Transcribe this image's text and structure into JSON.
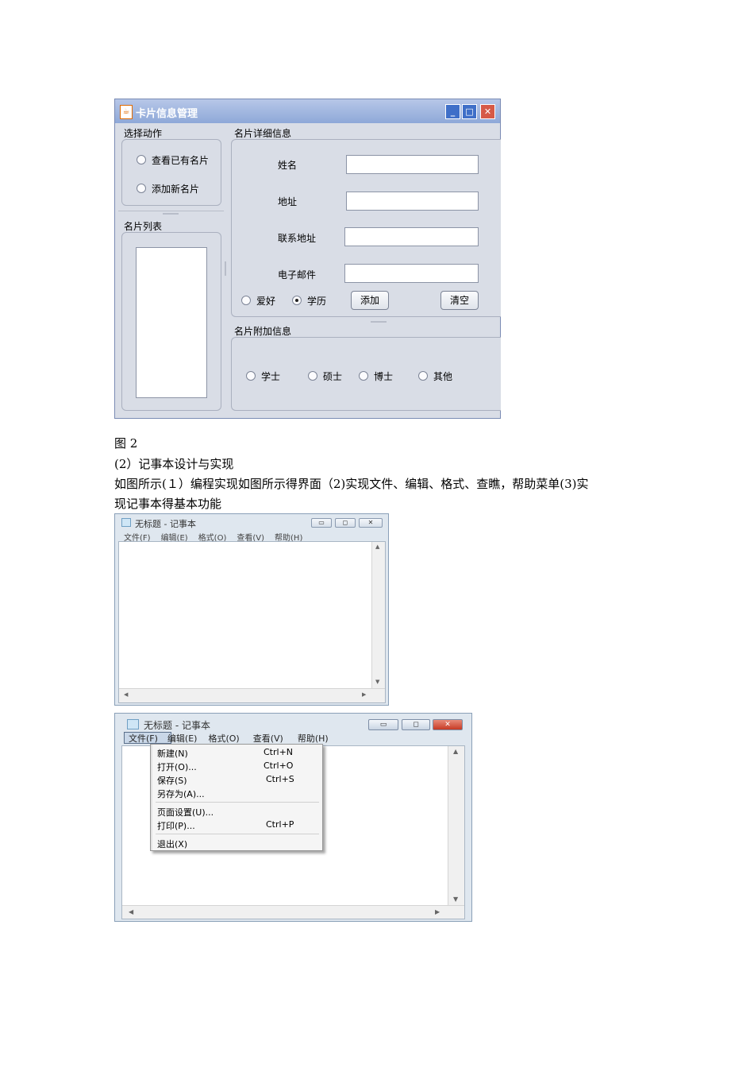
{
  "card_window": {
    "title": "卡片信息管理",
    "choose_action": {
      "label": "选择动作",
      "options": [
        "查看已有名片",
        "添加新名片"
      ]
    },
    "card_list": {
      "label": "名片列表"
    },
    "detail": {
      "label": "名片详细信息",
      "fields": [
        "姓名",
        "地址",
        "联系地址",
        "电子邮件"
      ],
      "radios": [
        "爱好",
        "学历"
      ],
      "selected_radio": "学历",
      "add_button": "添加",
      "clear_button": "清空"
    },
    "extra": {
      "label": "名片附加信息",
      "options": [
        "学士",
        "硕士",
        "博士",
        "其他"
      ]
    }
  },
  "text": {
    "figure_caption": "图 2",
    "section_heading": "(2）记事本设计与实现",
    "paragraph_line1": "如图所示(１）编程实现如图所示得界面（2)实现文件、编辑、格式、查瞧，帮助菜单(3)实",
    "paragraph_line2": "现记事本得基本功能"
  },
  "notepad1": {
    "title": "无标题 - 记事本",
    "menu": [
      "文件(F)",
      "编辑(E)",
      "格式(O)",
      "查看(V)",
      "帮助(H)"
    ]
  },
  "notepad2": {
    "title": "无标题 - 记事本",
    "menu": [
      "文件(F)",
      "编辑(E)",
      "格式(O)",
      "查看(V)",
      "帮助(H)"
    ],
    "file_menu": [
      {
        "label": "新建(N)",
        "shortcut": "Ctrl+N"
      },
      {
        "label": "打开(O)...",
        "shortcut": "Ctrl+O"
      },
      {
        "label": "保存(S)",
        "shortcut": "Ctrl+S"
      },
      {
        "label": "另存为(A)...",
        "shortcut": ""
      },
      {
        "label": "页面设置(U)...",
        "shortcut": ""
      },
      {
        "label": "打印(P)...",
        "shortcut": "Ctrl+P"
      },
      {
        "label": "退出(X)",
        "shortcut": ""
      }
    ]
  }
}
